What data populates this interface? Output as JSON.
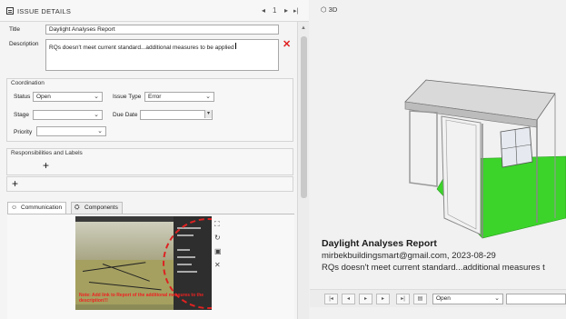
{
  "header": {
    "title": "ISSUE DETAILS",
    "page_number": "1"
  },
  "issue": {
    "title_label": "Title",
    "title_value": "Daylight Analyses Report",
    "description_label": "Description",
    "description_value": "RQs doesn't meet current standard...additional measures to be applied"
  },
  "coordination": {
    "heading": "Coordination",
    "status_label": "Status",
    "status_value": "Open",
    "issue_type_label": "Issue Type",
    "issue_type_value": "Error",
    "stage_label": "Stage",
    "stage_value": "",
    "due_date_label": "Due Date",
    "due_date_value": "",
    "priority_label": "Priority",
    "priority_value": ""
  },
  "responsibilities": {
    "heading": "Responsibilities and Labels"
  },
  "tabs": [
    {
      "label": "Communication",
      "icon": "chat-icon"
    },
    {
      "label": "Components",
      "icon": "components-icon"
    }
  ],
  "snapshot": {
    "note": "Note: Add link to Report of the additional measures to the description!!!"
  },
  "viewer": {
    "label": "3D",
    "issue_title": "Daylight Analyses Report",
    "issue_meta": "mirbekbuildingsmart@gmail.com, 2023-08-29",
    "issue_description": "RQs doesn't meet current standard...additional measures t",
    "status_filter": "Open"
  },
  "colors": {
    "accent_red": "#e02020",
    "floor_green": "#3cd42a",
    "panel_bg": "#f4f4f4"
  }
}
